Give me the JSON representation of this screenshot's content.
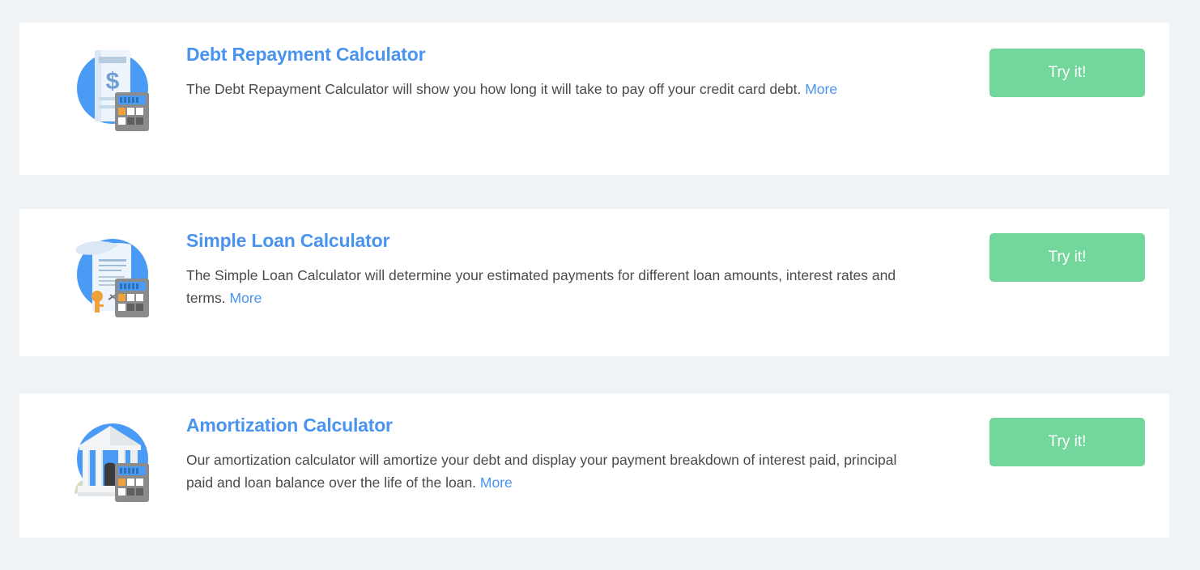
{
  "page": {
    "background_color": "#eff3f6",
    "card_background_color": "#ffffff",
    "accent_blue": "#4a94f0",
    "button_green": "#73d69b",
    "body_text_color": "#4a4a4a"
  },
  "cards": [
    {
      "icon": "invoice-dollar-calculator-icon",
      "title": "Debt Repayment Calculator",
      "description": "The Debt Repayment Calculator will show you how long it will take to pay off your credit card debt.",
      "more_label": "More",
      "button_label": "Try it!"
    },
    {
      "icon": "loan-document-key-calculator-icon",
      "title": "Simple Loan Calculator",
      "description": "The Simple Loan Calculator will determine your estimated payments for different loan amounts, interest rates and terms.",
      "more_label": "More",
      "button_label": "Try it!"
    },
    {
      "icon": "bank-building-calculator-icon",
      "title": "Amortization Calculator",
      "description": "Our amortization calculator will amortize your debt and display your payment breakdown of interest paid, principal paid and loan balance over the life of the loan.",
      "more_label": "More",
      "button_label": "Try it!"
    }
  ]
}
